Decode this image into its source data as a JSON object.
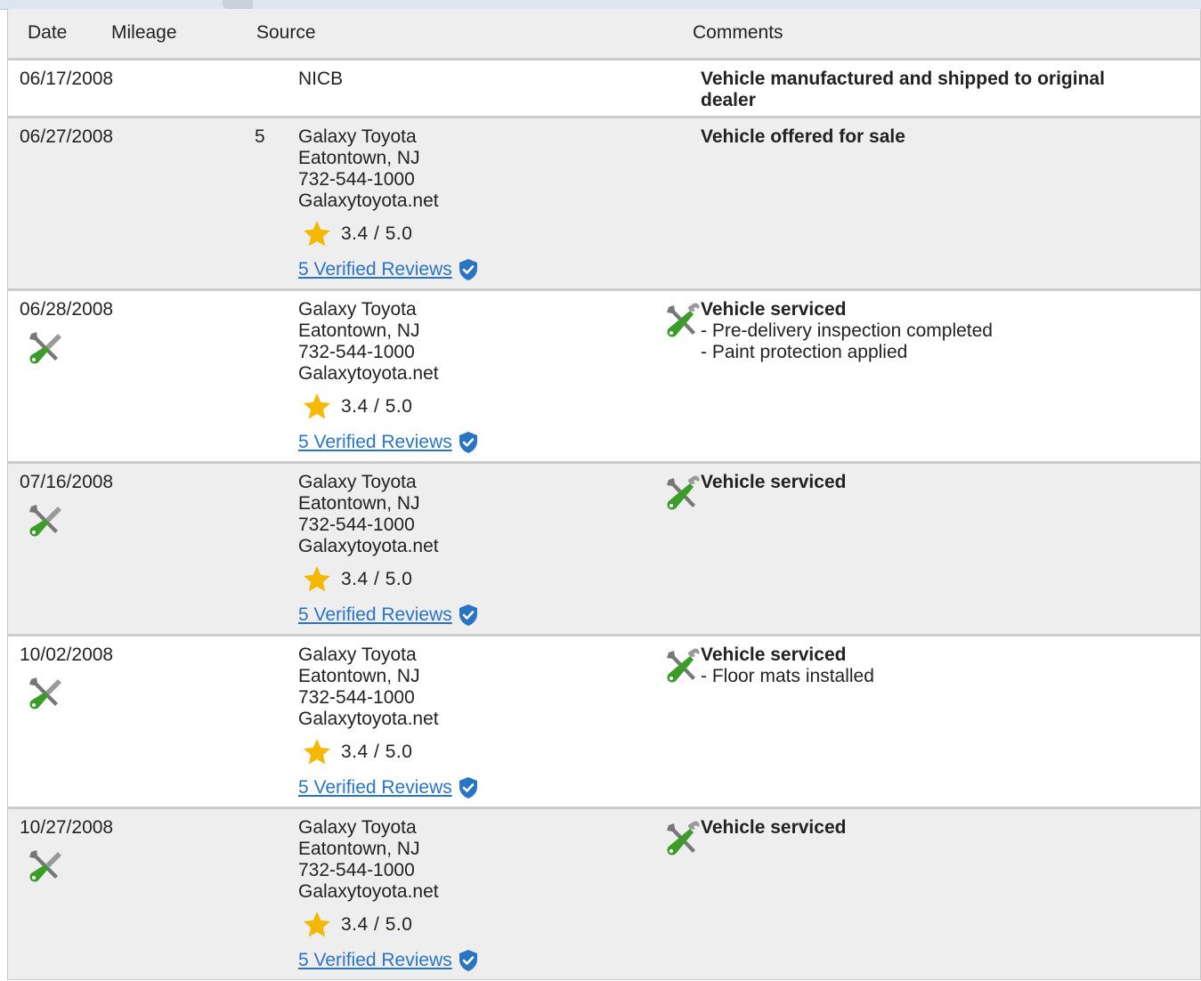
{
  "columns": {
    "date": "Date",
    "mileage": "Mileage",
    "source": "Source",
    "comments": "Comments"
  },
  "colors": {
    "header_bg": "#eeeeee",
    "row_alt": "#eeeeee",
    "link": "#2a74c4",
    "star": "#f5b800",
    "shield": "#2a74c4",
    "tool_green": "#3b9c2a"
  },
  "icons": {
    "service": "wrench-screwdriver-icon",
    "rating": "star-icon",
    "verified": "shield-check-icon"
  },
  "rows": [
    {
      "date": "06/17/2008",
      "mileage": "",
      "source_lines": [
        "NICB"
      ],
      "comment_title": "Vehicle manufactured and shipped to original dealer",
      "comment_lines": []
    },
    {
      "date": "06/27/2008",
      "mileage": "5",
      "source_lines": [
        "Galaxy Toyota",
        "Eatontown, NJ",
        "732-544-1000",
        "Galaxytoyota.net"
      ],
      "rating": "3.4 /  5.0",
      "reviews": "5 Verified Reviews",
      "comment_title": "Vehicle offered for sale",
      "comment_lines": []
    },
    {
      "date": "06/28/2008",
      "mileage": "",
      "source_lines": [
        "Galaxy Toyota",
        "Eatontown, NJ",
        "732-544-1000",
        "Galaxytoyota.net"
      ],
      "rating": "3.4 /  5.0",
      "reviews": "5 Verified Reviews",
      "comment_title": "Vehicle serviced",
      "comment_lines": [
        "- Pre-delivery inspection completed",
        "- Paint protection applied"
      ]
    },
    {
      "date": "07/16/2008",
      "mileage": "",
      "source_lines": [
        "Galaxy Toyota",
        "Eatontown, NJ",
        "732-544-1000",
        "Galaxytoyota.net"
      ],
      "rating": "3.4 /  5.0",
      "reviews": "5 Verified Reviews",
      "comment_title": "Vehicle serviced",
      "comment_lines": []
    },
    {
      "date": "10/02/2008",
      "mileage": "",
      "source_lines": [
        "Galaxy Toyota",
        "Eatontown, NJ",
        "732-544-1000",
        "Galaxytoyota.net"
      ],
      "rating": "3.4 /  5.0",
      "reviews": "5 Verified Reviews",
      "comment_title": "Vehicle serviced",
      "comment_lines": [
        "- Floor mats installed"
      ]
    },
    {
      "date": "10/27/2008",
      "mileage": "",
      "source_lines": [
        "Galaxy Toyota",
        "Eatontown, NJ",
        "732-544-1000",
        "Galaxytoyota.net"
      ],
      "rating": "3.4 /  5.0",
      "reviews": "5 Verified Reviews",
      "comment_title": "Vehicle serviced",
      "comment_lines": []
    }
  ]
}
